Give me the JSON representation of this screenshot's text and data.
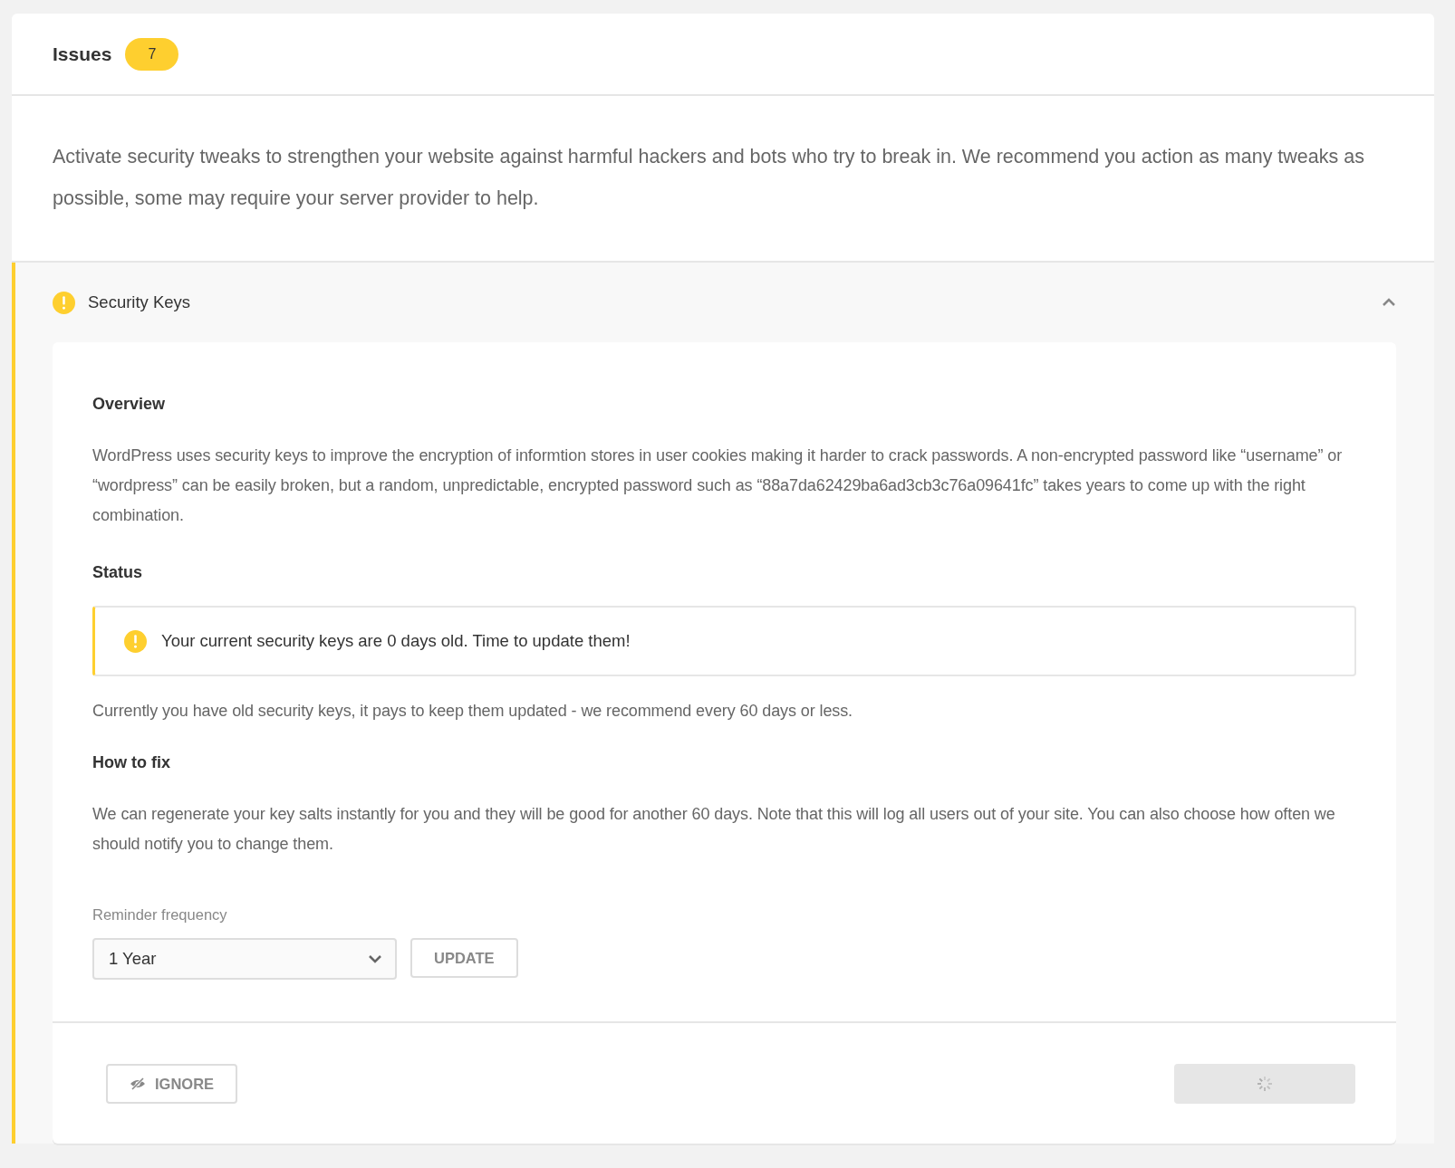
{
  "header": {
    "title": "Issues",
    "count": "7"
  },
  "description": "Activate security tweaks to strengthen your website against harmful hackers and bots who try to break in. We recommend you action as many tweaks as possible, some may require your server provider to help.",
  "issue": {
    "title": "Security Keys",
    "color": "#fecf2f",
    "expanded": true,
    "overview_heading": "Overview",
    "overview_text": "WordPress uses security keys to improve the encryption of informtion stores in user cookies making it harder to crack passwords. A non-encrypted password like “username” or “wordpress” can be easily broken, but a random, unpredictable, encrypted password such as “88a7da62429ba6ad3cb3c76a09641fc” takes years to come up with the right combination.",
    "status_heading": "Status",
    "notice": {
      "color": "#fecf2f",
      "text": "Your current security keys are 0 days old. Time to update them!"
    },
    "status_text": "Currently you have old security keys, it pays to keep them updated - we recommend every 60 days or less.",
    "fix_heading": "How to fix",
    "fix_text": "We can regenerate your key salts instantly for you and they will be good for another 60 days. Note that this will log all users out of your site. You can also choose how often we should notify you to change them.",
    "reminder": {
      "label": "Reminder frequency",
      "value": "1 Year",
      "button": "UPDATE"
    },
    "footer": {
      "ignore_button": "IGNORE",
      "action_loading": true
    }
  }
}
